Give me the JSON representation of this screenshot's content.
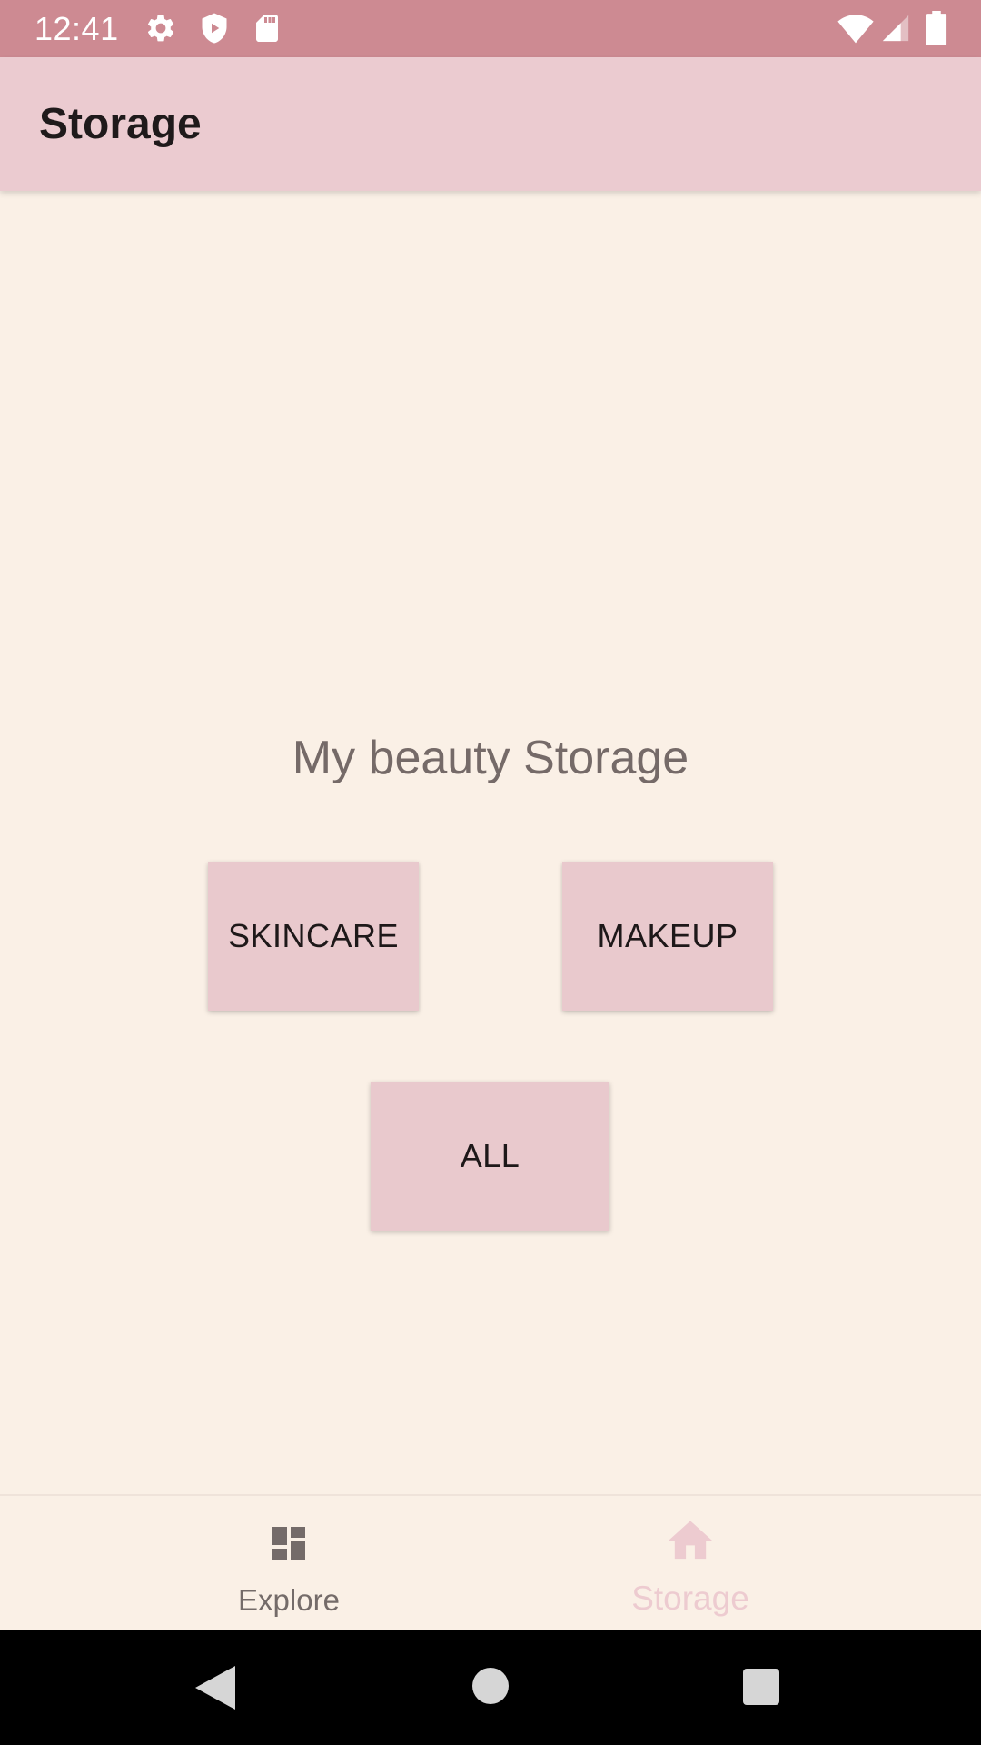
{
  "status_bar": {
    "time": "12:41",
    "icons": [
      "gear-icon",
      "shield-icon",
      "sd-card-icon",
      "wifi-icon",
      "signal-icon",
      "battery-icon"
    ]
  },
  "app_bar": {
    "title": "Storage"
  },
  "main": {
    "heading": "My beauty Storage",
    "buttons": {
      "skincare": "SKINCARE",
      "makeup": "MAKEUP",
      "all": "ALL"
    }
  },
  "bottom_nav": {
    "items": [
      {
        "label": "Explore",
        "icon": "dashboard-icon",
        "selected": false
      },
      {
        "label": "Storage",
        "icon": "home-icon",
        "selected": true
      }
    ]
  },
  "system_nav": {
    "icons": [
      "back-icon",
      "home-circle-icon",
      "recents-icon"
    ]
  },
  "colors": {
    "status_bar": "#CD8A92",
    "app_bar": "#EBCBD0",
    "background": "#FAF0E6",
    "button": "#E9C9CD",
    "nav_inactive": "#746B69",
    "nav_active": "#EDCBD0"
  }
}
